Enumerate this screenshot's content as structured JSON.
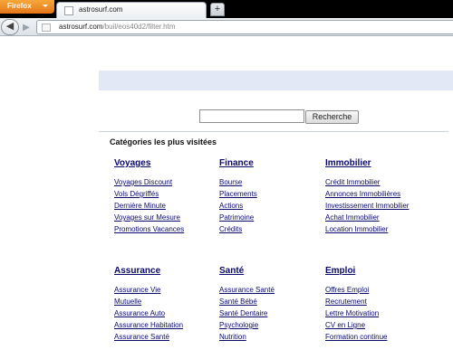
{
  "browser": {
    "menu_label": "Firefox",
    "tab_title": "astrosurf.com",
    "new_tab_label": "+",
    "url_domain": "astrosurf.com",
    "url_path": "/buil/eos40d2/filter.htm"
  },
  "search": {
    "input_value": "",
    "button_label": "Recherche"
  },
  "categories_title": "Catégories les plus visitées",
  "categories": [
    {
      "title": "Voyages",
      "links": [
        "Voyages Discount",
        "Vols Dégriffés",
        "Dernière Minute",
        "Voyages sur Mesure",
        "Promotions Vacances"
      ]
    },
    {
      "title": "Finance",
      "links": [
        "Bourse",
        "Placements",
        "Actions",
        "Patrimoine",
        "Crédits"
      ]
    },
    {
      "title": "Immobilier",
      "links": [
        "Crédit Immobilier",
        "Annonces Immobilières",
        "Investissement Immobilier",
        "Achat Immobilier",
        "Location Immobilier"
      ]
    },
    {
      "title": "Assurance",
      "links": [
        "Assurance Vie",
        "Mutuelle",
        "Assurance Auto",
        "Assurance Habitation",
        "Assurance Santé"
      ]
    },
    {
      "title": "Santé",
      "links": [
        "Assurance Santé",
        "Santé Bébé",
        "Santé Dentaire",
        "Psychologie",
        "Nutrition"
      ]
    },
    {
      "title": "Emploi",
      "links": [
        "Offres Emploi",
        "Recrutement",
        "Lettre Motivation",
        "CV en Ligne",
        "Formation continue"
      ]
    }
  ]
}
